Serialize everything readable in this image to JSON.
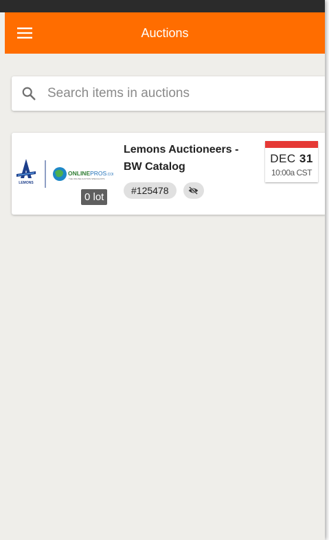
{
  "app_bar": {
    "title": "Auctions",
    "menu_icon": "hamburger-menu-icon",
    "background": "#ff6d00"
  },
  "search": {
    "placeholder": "Search items in auctions",
    "value": "",
    "icon": "search-icon"
  },
  "auctions": [
    {
      "title_line1": "Lemons Auctioneers -",
      "title_line2": "BW Catalog",
      "lot_count": "0 lot",
      "auction_id": "#125478",
      "visibility_icon": "eye-off-icon",
      "date_month": "DEC",
      "date_day": "31",
      "time": "10:00a CST",
      "logo_left_text": "LEMONS",
      "logo_right_text": "ONLINEPROS",
      "logo_right_suffix": ".COM",
      "logo_right_tagline": "THE ONLINE AUCTION SPECIALISTS"
    }
  ],
  "colors": {
    "accent": "#ff6d00",
    "date_bar": "#e53935",
    "background": "#efeeea"
  }
}
